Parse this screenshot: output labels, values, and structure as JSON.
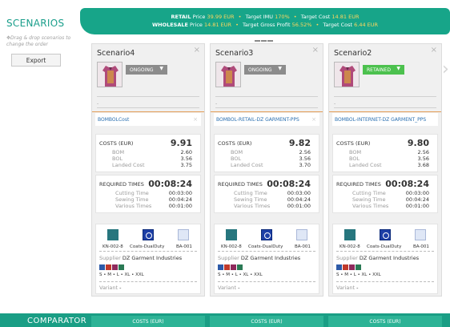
{
  "sidebar": {
    "title": "SCENARIOS",
    "hint": "Drag & drop scenarios to change the order",
    "export_label": "Export"
  },
  "price_bar": {
    "retail": {
      "label": "RETAIL",
      "price_label": "Price",
      "price": "39.99 EUR",
      "target1_label": "Target IMU",
      "target1": "170%",
      "target2_label": "Target Cost",
      "target2": "14.81 EUR"
    },
    "wholesale": {
      "label": "WHOLESALE",
      "price_label": "Price",
      "price": "14.81 EUR",
      "target1_label": "Target Gross Profit",
      "target1": "56.52%",
      "target2_label": "Target Cost",
      "target2": "6.44 EUR"
    }
  },
  "scenarios": [
    {
      "name": "Scenario4",
      "status": "ONGOING",
      "status_color": "#8c8c8c",
      "dash": "-",
      "cost_model": "BOMBOLCost",
      "costs_label": "COSTS (EUR)",
      "costs_total": "9.91",
      "bom_label": "BOM",
      "bom": "2.60",
      "bol_label": "BOL",
      "bol": "3.56",
      "landed_label": "Landed Cost",
      "landed": "3.75",
      "times_label": "REQUIRED TIMES",
      "times_total": "00:08:24",
      "cutting_label": "Cutting Time",
      "cutting": "00:03:00",
      "sewing_label": "Sewing Time",
      "sewing": "00:04:24",
      "various_label": "Various Times",
      "various": "00:01:00",
      "materials": [
        "KN-002-8",
        "Coats-DualDuty",
        "BA-001"
      ],
      "supplier_label": "Supplier",
      "supplier": "DZ Garment Industries",
      "sizes": "S • M • L • XL • XXL",
      "variant_label": "Variant",
      "variant": "-"
    },
    {
      "name": "Scenario3",
      "status": "ONGOING",
      "status_color": "#8c8c8c",
      "dash": "-",
      "cost_model": "BOMBOL-RETAIL-DZ GARMENT-PPS",
      "costs_label": "COSTS (EUR)",
      "costs_total": "9.82",
      "bom_label": "BOM",
      "bom": "2.56",
      "bol_label": "BOL",
      "bol": "3.56",
      "landed_label": "Landed Cost",
      "landed": "3.70",
      "times_label": "REQUIRED TIMES",
      "times_total": "00:08:24",
      "cutting_label": "Cutting Time",
      "cutting": "00:03:00",
      "sewing_label": "Sewing Time",
      "sewing": "00:04:24",
      "various_label": "Various Times",
      "various": "00:01:00",
      "materials": [
        "KN-002-8",
        "Coats-DualDuty",
        "BA-001"
      ],
      "supplier_label": "Supplier",
      "supplier": "DZ Garment Industries",
      "sizes": "S • M • L • XL • XXL",
      "variant_label": "Variant",
      "variant": "-"
    },
    {
      "name": "Scenario2",
      "status": "RETAINED",
      "status_color": "#4cc14e",
      "dash": "-",
      "cost_model": "BOMBOL-INTERNET-DZ GARMENT_PPS",
      "costs_label": "COSTS (EUR)",
      "costs_total": "9.80",
      "bom_label": "BOM",
      "bom": "2.56",
      "bol_label": "BOL",
      "bol": "3.56",
      "landed_label": "Landed Cost",
      "landed": "3.68",
      "times_label": "REQUIRED TIMES",
      "times_total": "00:08:24",
      "cutting_label": "Cutting Time",
      "cutting": "00:03:00",
      "sewing_label": "Sewing Time",
      "sewing": "00:04:24",
      "various_label": "Various Times",
      "various": "00:01:00",
      "materials": [
        "KN-002-8",
        "Coats-DualDuty",
        "BA-001"
      ],
      "supplier_label": "Supplier",
      "supplier": "DZ Garment Industries",
      "sizes": "S • M • L • XL • XXL",
      "variant_label": "Variant",
      "variant": "-"
    }
  ],
  "color_chips": [
    "#2d5aa8",
    "#c0392b",
    "#8e2a5c",
    "#2a7a55"
  ],
  "comparator": {
    "title": "COMPARATOR",
    "cells": [
      "COSTS (EUR)",
      "COSTS (EUR)",
      "COSTS (EUR)"
    ]
  },
  "icons": {
    "close": "close-icon",
    "next": "chevron-right-icon",
    "drag": "drag-icon",
    "dropdown": "chevron-down-icon"
  }
}
